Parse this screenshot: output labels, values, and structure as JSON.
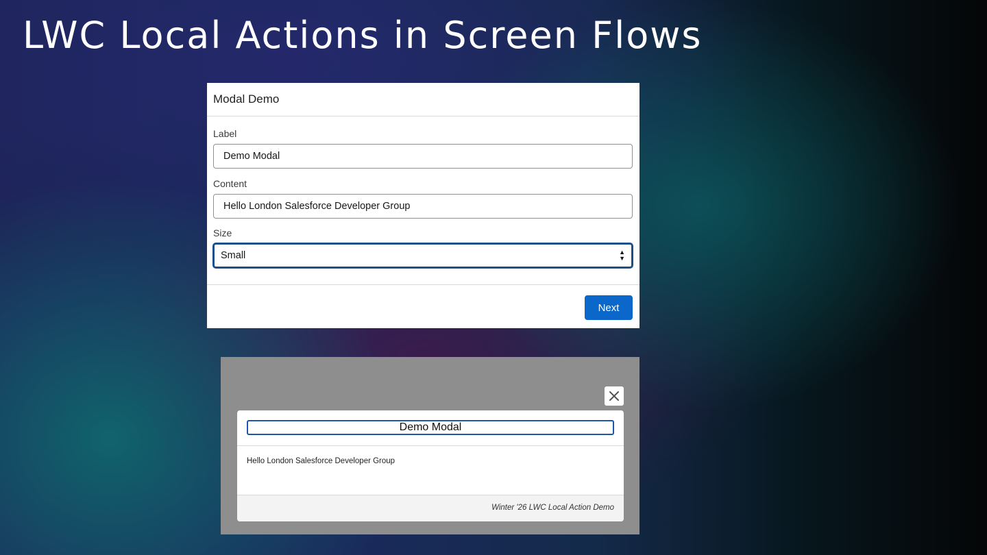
{
  "slide": {
    "title": "LWC Local Actions in Screen Flows"
  },
  "flow_screen": {
    "header": "Modal Demo",
    "fields": {
      "label": {
        "label": "Label",
        "value": "Demo Modal"
      },
      "content": {
        "label": "Content",
        "value": "Hello London Salesforce Developer Group"
      },
      "size": {
        "label": "Size",
        "selected": "Small"
      }
    },
    "next_label": "Next",
    "accent_color": "#0B67C9"
  },
  "modal_preview": {
    "close_icon": "close-icon",
    "title": "Demo Modal",
    "body": "Hello London Salesforce Developer Group",
    "footer": "Winter '26 LWC Local Action Demo"
  }
}
